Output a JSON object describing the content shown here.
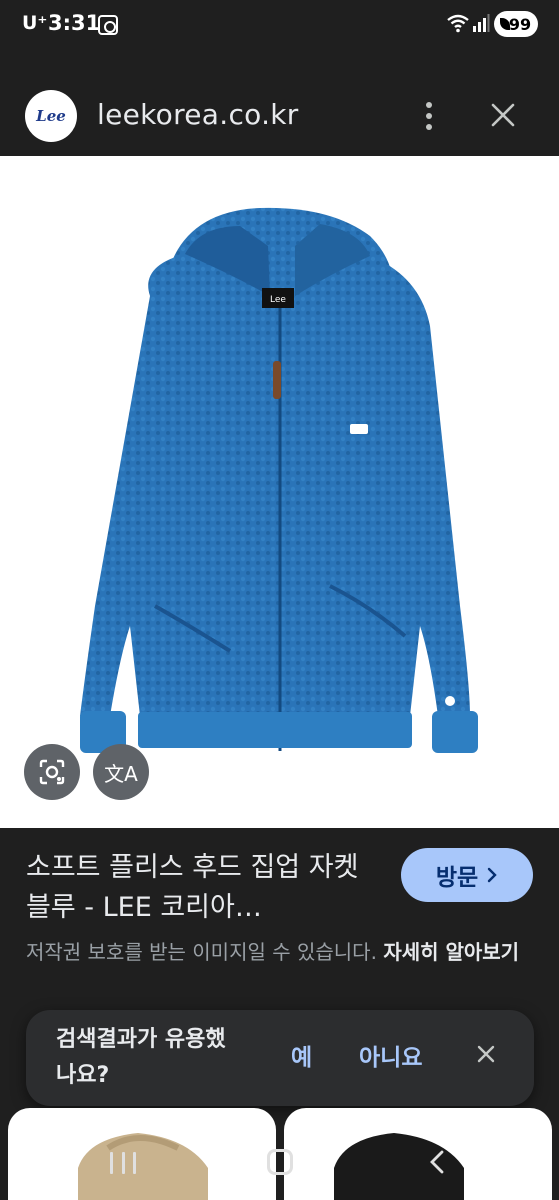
{
  "status_bar": {
    "carrier": "U⁺",
    "time": "3:31",
    "battery": "99",
    "icons": [
      "screenshot-icon",
      "wifi-icon",
      "signal-icon",
      "battery-icon"
    ]
  },
  "header": {
    "favicon_text": "Lee",
    "domain": "leekorea.co.kr",
    "icons": [
      "more-vert-icon",
      "close-icon"
    ]
  },
  "image": {
    "jacket_color": "#2a74b8",
    "jacket_dark": "#1e5a94",
    "label_text": "Lee",
    "lens_icon": "lens-icon",
    "translate_label": "文A"
  },
  "result": {
    "title": "소프트 플리스 후드 집업 자켓 블루 - LEE 코리아…",
    "visit_label": "방문",
    "copyright_text": "저작권 보호를 받는 이미지일 수 있습니다.",
    "learn_more": "자세히 알아보기"
  },
  "feedback": {
    "question": "검색결과가 유용했나요?",
    "yes": "예",
    "no": "아니요"
  },
  "thumbnails": [
    {
      "color": "#c9b38e",
      "name": "beige-fleece"
    },
    {
      "color": "#1a1a1a",
      "name": "black-fleece"
    }
  ],
  "colors": {
    "background": "#1f1f1f",
    "accent": "#a8c7fa",
    "visit_text": "#062e6f",
    "muted": "#9aa0a6"
  }
}
